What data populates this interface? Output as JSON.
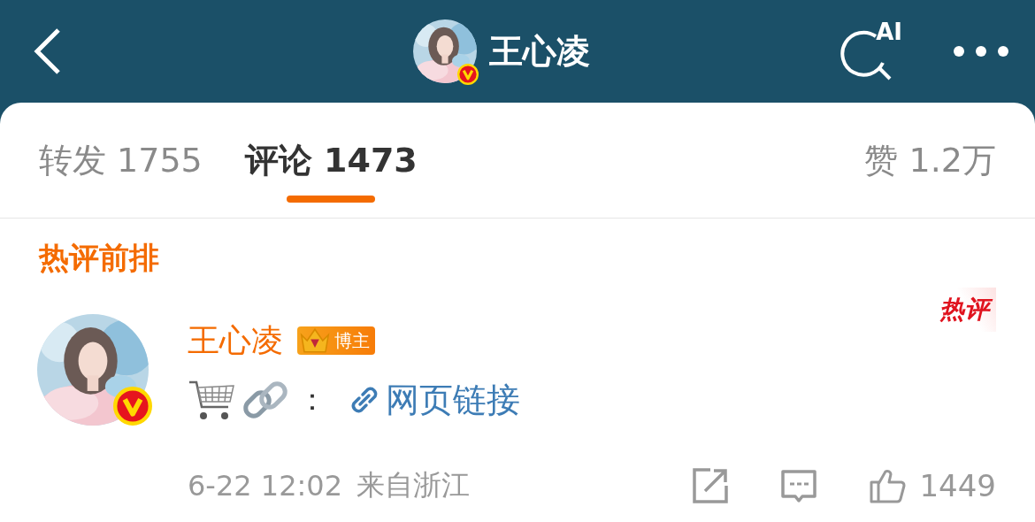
{
  "header": {
    "title": "王心凌",
    "verified": true,
    "ai_label": "AI"
  },
  "tabs": [
    {
      "label": "转发 1755",
      "selected": false
    },
    {
      "label": "评论 1473",
      "selected": true
    },
    {
      "label": "赞 1.2万",
      "selected": false
    }
  ],
  "section_title": "热评前排",
  "comments": [
    {
      "author": "王心凌",
      "verified": true,
      "badge": "博主",
      "hot_label": "热评",
      "colon": "：",
      "link": "网页链接",
      "time": "6-22 12:02",
      "location": "来自浙江",
      "likes": "1449"
    }
  ]
}
